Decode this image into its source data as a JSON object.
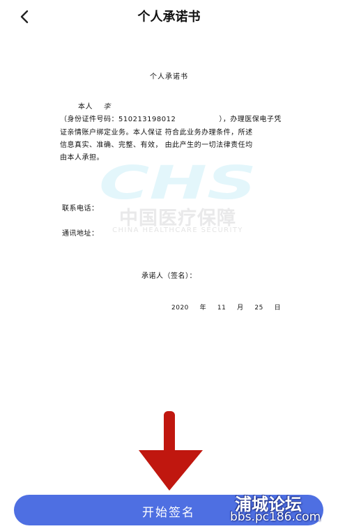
{
  "nav": {
    "title": "个人承诺书",
    "back_icon": "chevron-left-icon"
  },
  "document": {
    "title": "个人承诺书",
    "person_label": "本人",
    "person_name": "李",
    "id_line_start": "（身份证件号码：510213198012",
    "id_line_end": "），办理医保电子凭",
    "line2": "证亲情账户绑定业务。本人保证  符合此业务办理条件，所述",
    "line3": "信息真实、准确、完整、有效，  由此产生的一切法律责任均",
    "line4": "由本人承担。",
    "phone_label": "联系电话：",
    "address_label": "通讯地址：",
    "signer_label": "承诺人（签名）：",
    "date": {
      "year": "2020",
      "year_unit": "年",
      "month": "11",
      "month_unit": "月",
      "day": "25",
      "day_unit": "日"
    }
  },
  "watermark": {
    "logo_letters": "CHS",
    "chinese": "中国医疗保障",
    "english": "CHINA HEALTHCARE SECURITY",
    "color": "#e3f6fb"
  },
  "action": {
    "start_label": "开始签名",
    "color": "#4e6fe2"
  },
  "overlay": {
    "forum_name": "浦城论坛",
    "forum_url": "bbs.pc186.com",
    "arrow_color": "#c0170f"
  }
}
